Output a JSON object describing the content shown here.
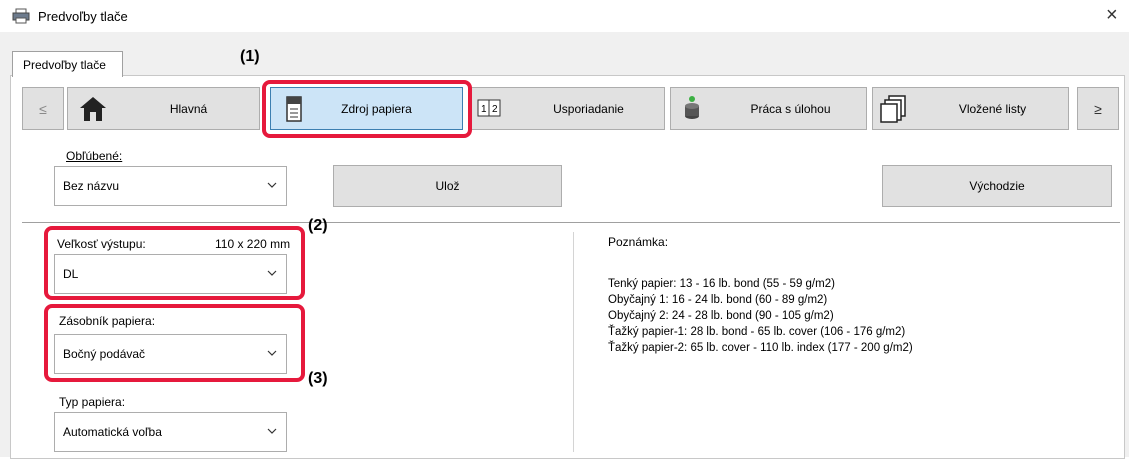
{
  "window": {
    "title": "Predvoľby tlače",
    "close_label": "×"
  },
  "tab": {
    "label": "Predvoľby tlače"
  },
  "nav": {
    "prev": "≤",
    "next": "≥",
    "buttons": [
      {
        "label": "Hlavná",
        "icon": "home-icon"
      },
      {
        "label": "Zdroj papiera",
        "icon": "printer-tray-icon",
        "selected": true
      },
      {
        "label": "Usporiadanie",
        "icon": "layout-icon"
      },
      {
        "label": "Práca s úlohou",
        "icon": "job-stack-icon"
      },
      {
        "label": "Vložené listy",
        "icon": "inserted-sheets-icon"
      }
    ]
  },
  "favorites": {
    "label": "Obľúbené:",
    "value": "Bez názvu",
    "save_label": "Ulož",
    "default_label": "Východzie"
  },
  "output_size": {
    "label": "Veľkosť výstupu:",
    "dimension": "110 x 220 mm",
    "value": "DL"
  },
  "paper_tray": {
    "label": "Zásobník papiera:",
    "value": "Bočný podávač"
  },
  "paper_type": {
    "label": "Typ papiera:",
    "value": "Automatická voľba"
  },
  "note": {
    "title": "Poznámka:",
    "lines": [
      "Tenký papier: 13 - 16 lb. bond (55 - 59 g/m2)",
      "Obyčajný 1: 16 - 24 lb. bond (60 - 89 g/m2)",
      "Obyčajný 2: 24 - 28 lb. bond (90 - 105 g/m2)",
      "Ťažký papier-1: 28 lb. bond - 65 lb. cover (106 - 176 g/m2)",
      "Ťažký papier-2: 65 lb. cover - 110 lb. index (177 - 200 g/m2)"
    ]
  },
  "callouts": {
    "c1": "(1)",
    "c2": "(2)",
    "c3": "(3)"
  },
  "colors": {
    "callout_red": "#e6193c",
    "selected_bg": "#cce4f7",
    "selected_border": "#3c7fb1"
  }
}
